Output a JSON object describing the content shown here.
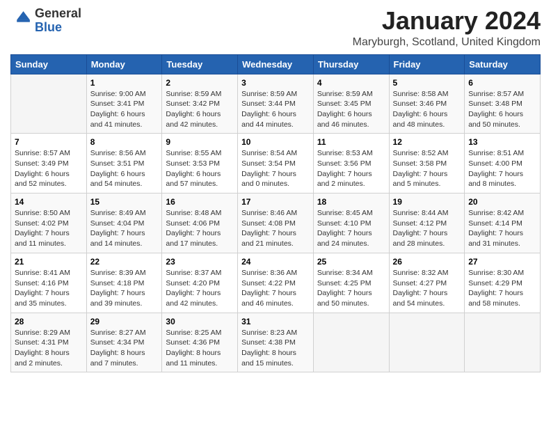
{
  "logo": {
    "general": "General",
    "blue": "Blue"
  },
  "title": "January 2024",
  "subtitle": "Maryburgh, Scotland, United Kingdom",
  "days_of_week": [
    "Sunday",
    "Monday",
    "Tuesday",
    "Wednesday",
    "Thursday",
    "Friday",
    "Saturday"
  ],
  "weeks": [
    [
      {
        "day": "",
        "sunrise": "",
        "sunset": "",
        "daylight": ""
      },
      {
        "day": "1",
        "sunrise": "Sunrise: 9:00 AM",
        "sunset": "Sunset: 3:41 PM",
        "daylight": "Daylight: 6 hours and 41 minutes."
      },
      {
        "day": "2",
        "sunrise": "Sunrise: 8:59 AM",
        "sunset": "Sunset: 3:42 PM",
        "daylight": "Daylight: 6 hours and 42 minutes."
      },
      {
        "day": "3",
        "sunrise": "Sunrise: 8:59 AM",
        "sunset": "Sunset: 3:44 PM",
        "daylight": "Daylight: 6 hours and 44 minutes."
      },
      {
        "day": "4",
        "sunrise": "Sunrise: 8:59 AM",
        "sunset": "Sunset: 3:45 PM",
        "daylight": "Daylight: 6 hours and 46 minutes."
      },
      {
        "day": "5",
        "sunrise": "Sunrise: 8:58 AM",
        "sunset": "Sunset: 3:46 PM",
        "daylight": "Daylight: 6 hours and 48 minutes."
      },
      {
        "day": "6",
        "sunrise": "Sunrise: 8:57 AM",
        "sunset": "Sunset: 3:48 PM",
        "daylight": "Daylight: 6 hours and 50 minutes."
      }
    ],
    [
      {
        "day": "7",
        "sunrise": "Sunrise: 8:57 AM",
        "sunset": "Sunset: 3:49 PM",
        "daylight": "Daylight: 6 hours and 52 minutes."
      },
      {
        "day": "8",
        "sunrise": "Sunrise: 8:56 AM",
        "sunset": "Sunset: 3:51 PM",
        "daylight": "Daylight: 6 hours and 54 minutes."
      },
      {
        "day": "9",
        "sunrise": "Sunrise: 8:55 AM",
        "sunset": "Sunset: 3:53 PM",
        "daylight": "Daylight: 6 hours and 57 minutes."
      },
      {
        "day": "10",
        "sunrise": "Sunrise: 8:54 AM",
        "sunset": "Sunset: 3:54 PM",
        "daylight": "Daylight: 7 hours and 0 minutes."
      },
      {
        "day": "11",
        "sunrise": "Sunrise: 8:53 AM",
        "sunset": "Sunset: 3:56 PM",
        "daylight": "Daylight: 7 hours and 2 minutes."
      },
      {
        "day": "12",
        "sunrise": "Sunrise: 8:52 AM",
        "sunset": "Sunset: 3:58 PM",
        "daylight": "Daylight: 7 hours and 5 minutes."
      },
      {
        "day": "13",
        "sunrise": "Sunrise: 8:51 AM",
        "sunset": "Sunset: 4:00 PM",
        "daylight": "Daylight: 7 hours and 8 minutes."
      }
    ],
    [
      {
        "day": "14",
        "sunrise": "Sunrise: 8:50 AM",
        "sunset": "Sunset: 4:02 PM",
        "daylight": "Daylight: 7 hours and 11 minutes."
      },
      {
        "day": "15",
        "sunrise": "Sunrise: 8:49 AM",
        "sunset": "Sunset: 4:04 PM",
        "daylight": "Daylight: 7 hours and 14 minutes."
      },
      {
        "day": "16",
        "sunrise": "Sunrise: 8:48 AM",
        "sunset": "Sunset: 4:06 PM",
        "daylight": "Daylight: 7 hours and 17 minutes."
      },
      {
        "day": "17",
        "sunrise": "Sunrise: 8:46 AM",
        "sunset": "Sunset: 4:08 PM",
        "daylight": "Daylight: 7 hours and 21 minutes."
      },
      {
        "day": "18",
        "sunrise": "Sunrise: 8:45 AM",
        "sunset": "Sunset: 4:10 PM",
        "daylight": "Daylight: 7 hours and 24 minutes."
      },
      {
        "day": "19",
        "sunrise": "Sunrise: 8:44 AM",
        "sunset": "Sunset: 4:12 PM",
        "daylight": "Daylight: 7 hours and 28 minutes."
      },
      {
        "day": "20",
        "sunrise": "Sunrise: 8:42 AM",
        "sunset": "Sunset: 4:14 PM",
        "daylight": "Daylight: 7 hours and 31 minutes."
      }
    ],
    [
      {
        "day": "21",
        "sunrise": "Sunrise: 8:41 AM",
        "sunset": "Sunset: 4:16 PM",
        "daylight": "Daylight: 7 hours and 35 minutes."
      },
      {
        "day": "22",
        "sunrise": "Sunrise: 8:39 AM",
        "sunset": "Sunset: 4:18 PM",
        "daylight": "Daylight: 7 hours and 39 minutes."
      },
      {
        "day": "23",
        "sunrise": "Sunrise: 8:37 AM",
        "sunset": "Sunset: 4:20 PM",
        "daylight": "Daylight: 7 hours and 42 minutes."
      },
      {
        "day": "24",
        "sunrise": "Sunrise: 8:36 AM",
        "sunset": "Sunset: 4:22 PM",
        "daylight": "Daylight: 7 hours and 46 minutes."
      },
      {
        "day": "25",
        "sunrise": "Sunrise: 8:34 AM",
        "sunset": "Sunset: 4:25 PM",
        "daylight": "Daylight: 7 hours and 50 minutes."
      },
      {
        "day": "26",
        "sunrise": "Sunrise: 8:32 AM",
        "sunset": "Sunset: 4:27 PM",
        "daylight": "Daylight: 7 hours and 54 minutes."
      },
      {
        "day": "27",
        "sunrise": "Sunrise: 8:30 AM",
        "sunset": "Sunset: 4:29 PM",
        "daylight": "Daylight: 7 hours and 58 minutes."
      }
    ],
    [
      {
        "day": "28",
        "sunrise": "Sunrise: 8:29 AM",
        "sunset": "Sunset: 4:31 PM",
        "daylight": "Daylight: 8 hours and 2 minutes."
      },
      {
        "day": "29",
        "sunrise": "Sunrise: 8:27 AM",
        "sunset": "Sunset: 4:34 PM",
        "daylight": "Daylight: 8 hours and 7 minutes."
      },
      {
        "day": "30",
        "sunrise": "Sunrise: 8:25 AM",
        "sunset": "Sunset: 4:36 PM",
        "daylight": "Daylight: 8 hours and 11 minutes."
      },
      {
        "day": "31",
        "sunrise": "Sunrise: 8:23 AM",
        "sunset": "Sunset: 4:38 PM",
        "daylight": "Daylight: 8 hours and 15 minutes."
      },
      {
        "day": "",
        "sunrise": "",
        "sunset": "",
        "daylight": ""
      },
      {
        "day": "",
        "sunrise": "",
        "sunset": "",
        "daylight": ""
      },
      {
        "day": "",
        "sunrise": "",
        "sunset": "",
        "daylight": ""
      }
    ]
  ]
}
